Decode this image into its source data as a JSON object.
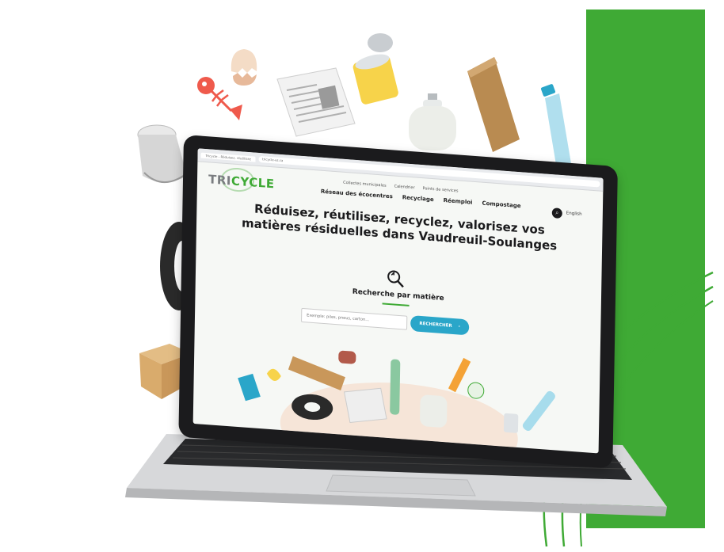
{
  "browser": {
    "tab_label": "Tricycle - Réduisez, réutilisez",
    "url": "tricycle-vs.ca"
  },
  "site": {
    "logo_tri": "TRI",
    "logo_cycle": "CYCLE",
    "top_links": [
      "Collectes municipales",
      "Calendrier",
      "Points de services"
    ],
    "main_nav": [
      "Réseau des écocentres",
      "Recyclage",
      "Réemploi",
      "Compostage"
    ],
    "language_label": "English",
    "hero_line1": "Réduisez, réutilisez, recyclez, valorisez vos",
    "hero_line2": "matières résiduelles dans Vaudreuil-Soulanges",
    "search_heading": "Recherche par matière",
    "search_placeholder": "Exemple: piles, pneus, carton...",
    "search_button": "RECHERCHER"
  },
  "icons": {
    "search": "search-icon",
    "recycle_search": "recycle-magnifier-icon",
    "arrow": "arrow-right-icon"
  },
  "colors": {
    "brand_green": "#3faa35",
    "button_blue": "#2aa6c9",
    "laptop_body": "#1b1b1d"
  }
}
